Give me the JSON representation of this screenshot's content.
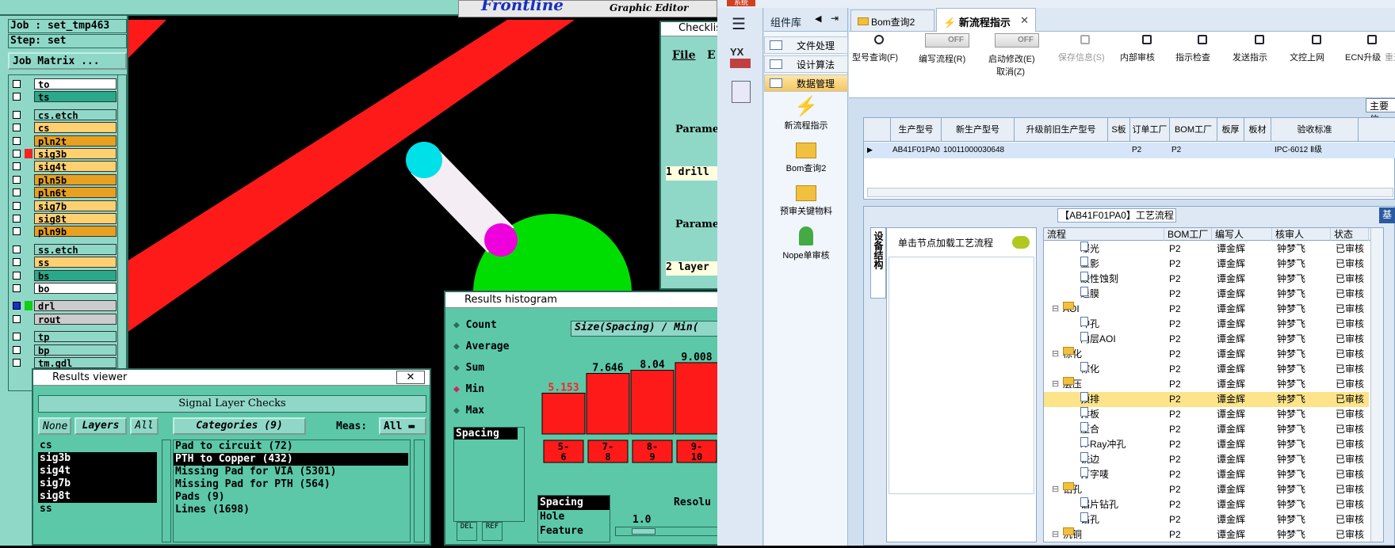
{
  "cad": {
    "job_label": "Job : set_tmp463",
    "step_label": "Step: set",
    "job_matrix": "Job Matrix ...",
    "brand": "Frontline",
    "brand_sub": "Graphic Editor",
    "layers": [
      {
        "name": "to",
        "color": "#ffffff"
      },
      {
        "name": "ts",
        "color": "#2aa88a"
      },
      {
        "name": "cs.etch",
        "color": "#8fd8c8"
      },
      {
        "name": "cs",
        "color": "#ffd070"
      },
      {
        "name": "pln2t",
        "color": "#e8a020"
      },
      {
        "name": "sig3b",
        "color": "#ffd070"
      },
      {
        "name": "sig4t",
        "color": "#ffd070"
      },
      {
        "name": "pln5b",
        "color": "#e8a020"
      },
      {
        "name": "pln6t",
        "color": "#e8a020"
      },
      {
        "name": "sig7b",
        "color": "#ffd070"
      },
      {
        "name": "sig8t",
        "color": "#ffd070"
      },
      {
        "name": "pln9b",
        "color": "#e8a020"
      },
      {
        "name": "ss.etch",
        "color": "#8fd8c8"
      },
      {
        "name": "ss",
        "color": "#ffd070"
      },
      {
        "name": "bs",
        "color": "#2aa88a"
      },
      {
        "name": "bo",
        "color": "#ffffff"
      },
      {
        "name": "drl",
        "color": "#cccccc"
      },
      {
        "name": "rout",
        "color": "#cccccc"
      },
      {
        "name": "tp",
        "color": "#8fd8c8"
      },
      {
        "name": "bp",
        "color": "#8fd8c8"
      },
      {
        "name": "tm.gdl",
        "color": "#8fd8c8"
      }
    ]
  },
  "checklist": {
    "title": "Checklis",
    "menu_file": "File",
    "menu_edit": "E",
    "param1": "Parame",
    "drill": "1 drill",
    "param2": "Parame",
    "layer": "2 layer"
  },
  "results_viewer": {
    "title": "Results viewer",
    "header": "Signal Layer Checks",
    "none": "None",
    "layers": "Layers",
    "all": "All",
    "categories": "Categories (9)",
    "meas": "Meas:",
    "meas_val": "All",
    "layer_list": [
      "cs",
      "sig3b",
      "sig4t",
      "sig7b",
      "sig8t",
      "ss"
    ],
    "category_list": [
      "Pad to circuit (72)",
      "PTH to Copper (432)",
      "Missing Pad for VIA (5301)",
      "Missing Pad for PTH (564)",
      "Pads (9)",
      "Lines (1698)"
    ]
  },
  "histogram": {
    "title": "Results histogram",
    "options": [
      "Count",
      "Average",
      "Sum",
      "Min",
      "Max"
    ],
    "selected": "Min",
    "list_item": "Spacing",
    "header": "Size(Spacing) / Min(",
    "bars": [
      {
        "label": "5.153",
        "value": 5.153,
        "range": "5-6"
      },
      {
        "label": "7.646",
        "value": 7.646,
        "range": "7-8"
      },
      {
        "label": "8.04",
        "value": 8.04,
        "range": "8-9"
      },
      {
        "label": "9.008",
        "value": 9.008,
        "range": "9-10"
      }
    ],
    "bottom_list": [
      "Spacing",
      "Hole",
      "Feature"
    ],
    "resol": "Resolu",
    "resol_val": "1.0",
    "del": "DEL",
    "ref": "REF"
  },
  "erp": {
    "top_tab": "系统",
    "sidebar_title": "组件库",
    "yx": "YX",
    "sidebar_items": [
      "文件处理",
      "设计算法",
      "数据管理"
    ],
    "launch": [
      "新流程指示",
      "Bom查询2",
      "预审关键物料",
      "Nope单审核"
    ],
    "tabs": [
      "Bom查询2",
      "新流程指示"
    ],
    "toolbar": [
      {
        "label": "型号查询(F)"
      },
      {
        "label": "编写流程(R)",
        "toggle": "OFF"
      },
      {
        "label": "启动修改(E)",
        "sub": "取消(Z)",
        "toggle": "OFF"
      },
      {
        "label": "保存信息(S)"
      },
      {
        "label": "内部审核"
      },
      {
        "label": "指示检查"
      },
      {
        "label": "发送指示"
      },
      {
        "label": "文控上网"
      },
      {
        "label": "ECN升级"
      },
      {
        "label": "重选"
      }
    ],
    "main_label": "主要信",
    "grid_headers": [
      "生产型号",
      "新生产型号",
      "升级前旧生产型号",
      "S板",
      "订单工厂",
      "BOM工厂",
      "板厚",
      "板材",
      "验收标准"
    ],
    "grid_row": [
      "AB41F01PA0",
      "10011000030648",
      "",
      "",
      "P2",
      "P2",
      "",
      "",
      "IPC-6012 Ⅱ级"
    ],
    "process_title": "【AB41F01PA0】工艺流程",
    "device_label": "设备结构",
    "device_hint": "单击节点加载工艺流程",
    "tree_headers": [
      "流程",
      "BOM工厂",
      "编写人",
      "核审人",
      "状态"
    ],
    "tree": [
      {
        "name": "曝光",
        "f": "P2",
        "w": "谭金辉",
        "r": "钟梦飞",
        "s": "已审核",
        "lvl": 2
      },
      {
        "name": "显影",
        "f": "P2",
        "w": "谭金辉",
        "r": "钟梦飞",
        "s": "已审核",
        "lvl": 2
      },
      {
        "name": "酸性蚀刻",
        "f": "P2",
        "w": "谭金辉",
        "r": "钟梦飞",
        "s": "已审核",
        "lvl": 2
      },
      {
        "name": "退膜",
        "f": "P2",
        "w": "谭金辉",
        "r": "钟梦飞",
        "s": "已审核",
        "lvl": 2
      },
      {
        "name": "AOI",
        "f": "P2",
        "w": "谭金辉",
        "r": "钟梦飞",
        "s": "已审核",
        "lvl": 1
      },
      {
        "name": "冲孔",
        "f": "P2",
        "w": "谭金辉",
        "r": "钟梦飞",
        "s": "已审核",
        "lvl": 2
      },
      {
        "name": "内层AOI",
        "f": "P2",
        "w": "谭金辉",
        "r": "钟梦飞",
        "s": "已审核",
        "lvl": 2
      },
      {
        "name": "棕化",
        "f": "P2",
        "w": "谭金辉",
        "r": "钟梦飞",
        "s": "已审核",
        "lvl": 1
      },
      {
        "name": "棕化",
        "f": "P2",
        "w": "谭金辉",
        "r": "钟梦飞",
        "s": "已审核",
        "lvl": 2
      },
      {
        "name": "层压",
        "f": "P2",
        "w": "谭金辉",
        "r": "钟梦飞",
        "s": "已审核",
        "lvl": 1
      },
      {
        "name": "预排",
        "f": "P2",
        "w": "谭金辉",
        "r": "钟梦飞",
        "s": "已审核",
        "lvl": 2,
        "sel": true
      },
      {
        "name": "排板",
        "f": "P2",
        "w": "谭金辉",
        "r": "钟梦飞",
        "s": "已审核",
        "lvl": 2
      },
      {
        "name": "压合",
        "f": "P2",
        "w": "谭金辉",
        "r": "钟梦飞",
        "s": "已审核",
        "lvl": 2
      },
      {
        "name": "X-Ray冲孔",
        "f": "P2",
        "w": "谭金辉",
        "r": "钟梦飞",
        "s": "已审核",
        "lvl": 2
      },
      {
        "name": "铣边",
        "f": "P2",
        "w": "谭金辉",
        "r": "钟梦飞",
        "s": "已审核",
        "lvl": 2
      },
      {
        "name": "打字唛",
        "f": "P2",
        "w": "谭金辉",
        "r": "钟梦飞",
        "s": "已审核",
        "lvl": 2
      },
      {
        "name": "钻孔",
        "f": "P2",
        "w": "谭金辉",
        "r": "钟梦飞",
        "s": "已审核",
        "lvl": 1
      },
      {
        "name": "铝片钻孔",
        "f": "P2",
        "w": "谭金辉",
        "r": "钟梦飞",
        "s": "已审核",
        "lvl": 2
      },
      {
        "name": "钻孔",
        "f": "P2",
        "w": "谭金辉",
        "r": "钟梦飞",
        "s": "已审核",
        "lvl": 2
      },
      {
        "name": "沉铜",
        "f": "P2",
        "w": "谭金辉",
        "r": "钟梦飞",
        "s": "已审核",
        "lvl": 1
      }
    ],
    "right_edge": "基"
  }
}
